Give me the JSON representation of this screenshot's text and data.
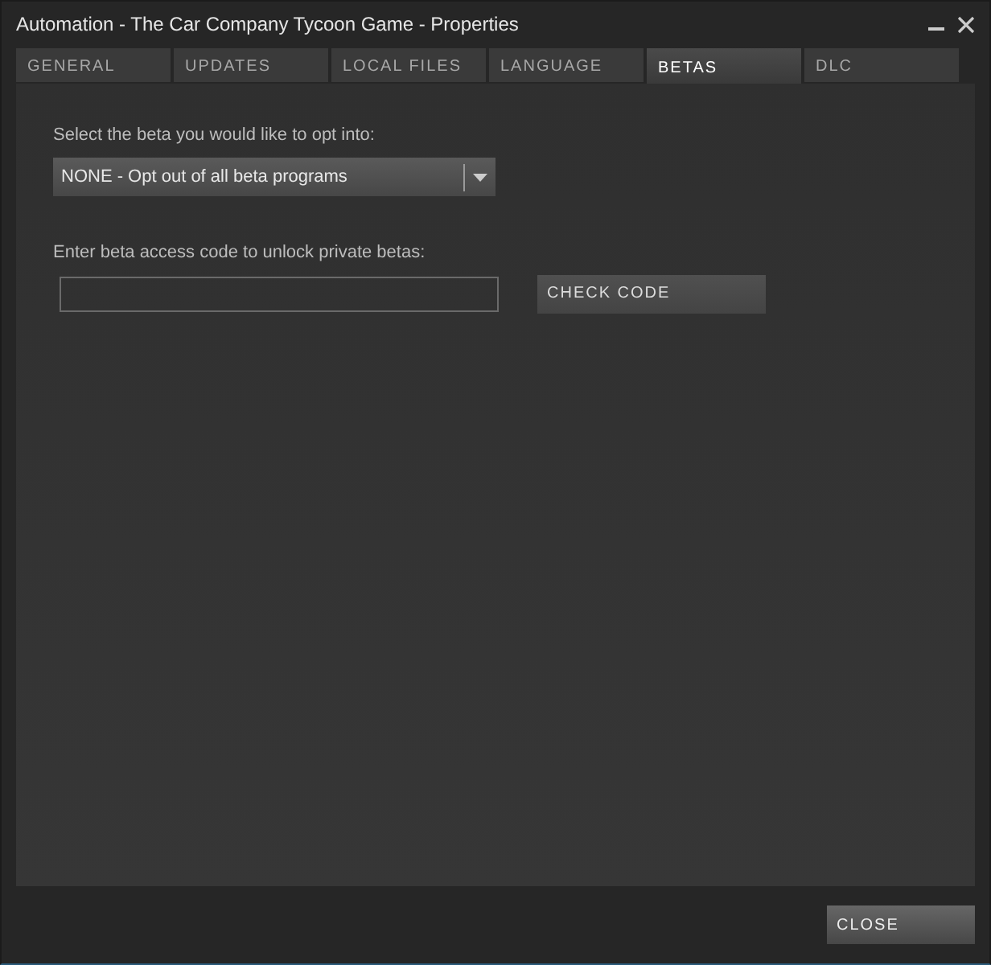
{
  "window": {
    "title": "Automation - The Car Company Tycoon Game - Properties"
  },
  "tabs": [
    {
      "label": "GENERAL",
      "selected": false
    },
    {
      "label": "UPDATES",
      "selected": false
    },
    {
      "label": "LOCAL FILES",
      "selected": false
    },
    {
      "label": "LANGUAGE",
      "selected": false
    },
    {
      "label": "BETAS",
      "selected": true
    },
    {
      "label": "DLC",
      "selected": false
    }
  ],
  "beta_select": {
    "label": "Select the beta you would like to opt into:",
    "value": "NONE - Opt out of all beta programs"
  },
  "access_code": {
    "label": "Enter beta access code to unlock private betas:",
    "button": "CHECK CODE"
  },
  "buttons": [
    "CLOSE"
  ]
}
